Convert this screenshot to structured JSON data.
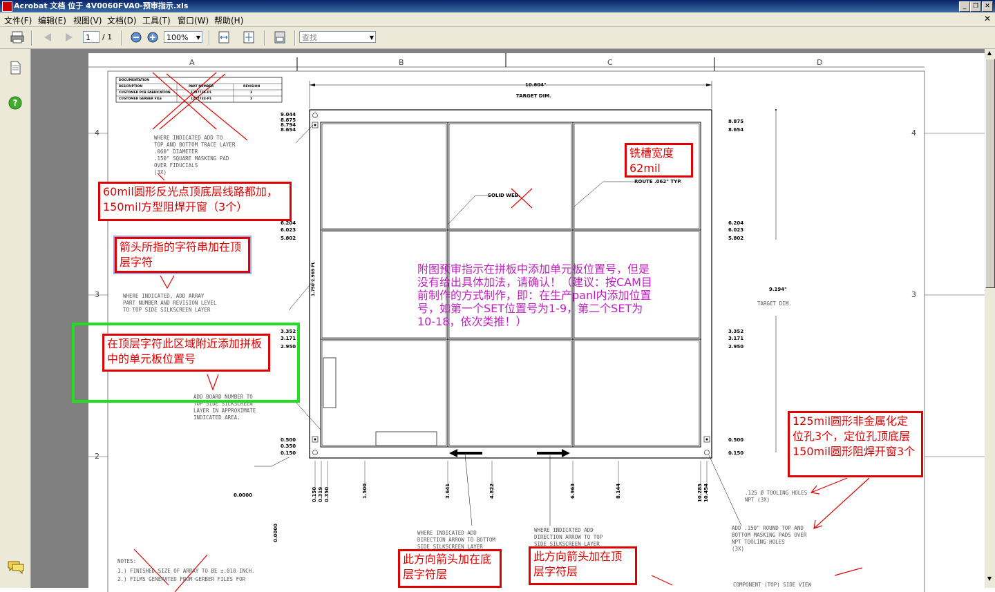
{
  "window": {
    "title": "Acrobat 文档 位于 4V0060FVA0-预审指示.xls"
  },
  "menu": {
    "items": [
      "文件(F)",
      "编辑(E)",
      "视图(V)",
      "文档(D)",
      "工具(T)",
      "窗口(W)",
      "帮助(H)"
    ]
  },
  "toolbar": {
    "page_value": "1",
    "page_total": "/ 1",
    "zoom_value": "100%",
    "search_placeholder": "查找"
  },
  "drawing": {
    "columns": [
      "A",
      "B",
      "C",
      "D"
    ],
    "rows": [
      "4",
      "3",
      "2"
    ],
    "title_block": {
      "rows": [
        [
          "DOCUMENTATION",
          "",
          ""
        ],
        [
          "DESCRIPTION",
          "PART NUMBER",
          "REVISION"
        ],
        [
          "CUSTOMER PCB FABRICATION",
          "1287734-P1",
          "3"
        ],
        [
          "CUSTOMER GERBER FILE",
          "1287734-P1",
          "3"
        ]
      ]
    },
    "width_dim": "10.604\"",
    "width_label": "TARGET DIM.",
    "height_dim": "9.194\"",
    "height_label": "TARGET DIM.",
    "left_dims_top": [
      "9.044",
      "8.875",
      "8.794",
      "8.654"
    ],
    "left_dims_mid1": [
      "6.204",
      "6.023",
      "5.802"
    ],
    "left_dims_mid2": [
      "3.352",
      "3.171",
      "2.950"
    ],
    "left_dims_bot": [
      "0.500",
      "0.350",
      "0.150"
    ],
    "right_dims_top": [
      "8.875",
      "8.654"
    ],
    "right_dims_mid1": [
      "6.204",
      "6.023",
      "5.802"
    ],
    "right_dims_mid2": [
      "3.352",
      "3.171",
      "2.950"
    ],
    "right_dims_bot": [
      "0.500",
      "0.150"
    ],
    "bottom_dims": [
      "0.150",
      "0.319",
      "0.350",
      "1.500",
      "3.641",
      "4.822",
      "6.963",
      "8.144",
      "10.285",
      "10.454"
    ],
    "origin_x": "0.0000",
    "origin_y": "0.0000",
    "solid_web": "SOLID WEB.",
    "route": "ROUTE .062\" TYP.",
    "vertical_label": "1.750 2.969 PL",
    "note_fiducial": "WHERE INDICATED ADD TO\nTOP AND BOTTOM TRACE LAYER\n.060\" DIAMETER\n.150\" SQUARE MASKING PAD\nOVER FIDUCIALS\n(3X)",
    "note_array_pn": "WHERE INDICATED, ADD ARRAY\nPART NUMBER AND REVISION LEVEL\nTO TOP SIDE SILKSCREEN LAYER",
    "note_board_number": "ADD BOARD NUMBER TO\nTOP SIDE SILKSCREEN\nLAYER IN APPROXIMATE\nINDICATED AREA.",
    "note_arrow_bottom": "WHERE INDICATED ADD\nDIRECTION ARROW TO BOTTOM\nSIDE SILKSCREEN LAYER",
    "note_arrow_top": "WHERE INDICATED ADD\nDIRECTION ARROW TO TOP\nSIDE SILKSCREEN LAYER",
    "note_tooling": ".125 Ø TOOLING HOLES\nNPT (3X)",
    "note_round_pads": "ADD .150\" ROUND TOP AND\nBOTTOM MASKING PADS OVER\nNPT TOOLING HOLES\n(3X)",
    "notes_title": "NOTES:",
    "notes": [
      "1.) FINISHED SIZE OF ARRAY TO BE ±.010 INCH.",
      "2.) FILMS GENERATED FROM GERBER FILES FOR"
    ],
    "component_view": "COMPONENT (TOP) SIDE VIEW"
  },
  "annotations": {
    "fiducial_cn": "60mil圆形反光点顶底层线路都加，150mil方型阻焊开窗（3个）",
    "arrow_pn_cn": "箭头所指的字符串加在顶层字符",
    "slot_cn": "铣槽宽度62mil",
    "board_pos_cn": "在顶层字符此区域附近添加拼板中的单元板位置号",
    "question_cn": "附图预审指示在拼板中添加单元板位置号，但是没有给出具体加法，请确认！（建议：按CAM目前制作的方式制作，即：在生产panl内添加位置号，如第一个SET位置号为1-9，第二个SET为10-18，依次类推！）",
    "tooling_cn": "125mil圆形非金属化定位孔3个，定位孔顶底层150mil圆形阻焊开窗3个",
    "arrow_bottom_cn": "此方向箭头加在底层字符层",
    "arrow_top_cn": "此方向箭头加在顶层字符层"
  },
  "colors": {
    "annotation_red": "#e00000",
    "note_magenta": "#c020c0",
    "highlight_green": "#22dd22"
  }
}
